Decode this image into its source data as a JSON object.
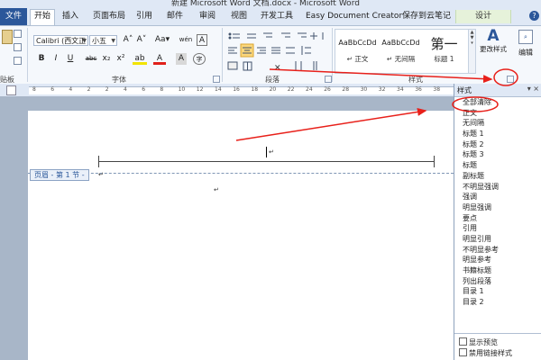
{
  "window": {
    "title": "新建 Microsoft Word 文档.docx - Microsoft Word"
  },
  "tabs": [
    {
      "label": "文件"
    },
    {
      "label": "开始"
    },
    {
      "label": "插入"
    },
    {
      "label": "页面布局"
    },
    {
      "label": "引用"
    },
    {
      "label": "邮件"
    },
    {
      "label": "审阅"
    },
    {
      "label": "视图"
    },
    {
      "label": "开发工具"
    },
    {
      "label": "Easy Document Creator"
    },
    {
      "label": "保存到云笔记"
    },
    {
      "label": "设计"
    }
  ],
  "ribbon": {
    "clipboard_label": "贴板",
    "font_name": "Calibri (西文正",
    "font_size": "小五",
    "font_label": "字体",
    "paragraph_label": "段落",
    "styles_label": "样式",
    "gallery": [
      {
        "sample": "AaBbCcDd",
        "name": "↵ 正文"
      },
      {
        "sample": "AaBbCcDd",
        "name": "↵ 无间隔"
      },
      {
        "sample": "第一",
        "name": "标题 1"
      }
    ],
    "change_styles_label": "更改样式",
    "edit_label": "编辑",
    "glyphs": {
      "grow": "A˄",
      "shrink": "A˅",
      "case": "Aa▾",
      "phonetic": "wén",
      "clear": "A",
      "bold": "B",
      "italic": "I",
      "underline": "U",
      "strike": "abc",
      "sub": "x₂",
      "sup": "x²",
      "highlight": "ab",
      "fontcolor": "A",
      "charborder": "A",
      "enclose": "字"
    }
  },
  "ruler": {
    "numbers": [
      "8",
      "6",
      "4",
      "2",
      "2",
      "4",
      "6",
      "8",
      "10",
      "12",
      "14",
      "16",
      "18",
      "20",
      "22",
      "24",
      "26",
      "28",
      "30",
      "32",
      "34",
      "36",
      "38"
    ]
  },
  "document": {
    "header_tag": "页眉 - 第 1 节 -",
    "para_mark": "↵"
  },
  "styles_pane": {
    "title": "样式",
    "close": "▾ ×",
    "items": [
      "全部清除",
      "正文",
      "无间隔",
      "标题 1",
      "标题 2",
      "标题 3",
      "标题",
      "副标题",
      "不明显强调",
      "强调",
      "明显强调",
      "要点",
      "引用",
      "明显引用",
      "不明显参考",
      "明显参考",
      "书籍标题",
      "列出段落",
      "目录 1",
      "目录 2"
    ],
    "show_preview": "显示预览",
    "disable_linked": "禁用链接样式"
  },
  "annotation_color": "#e8201a"
}
